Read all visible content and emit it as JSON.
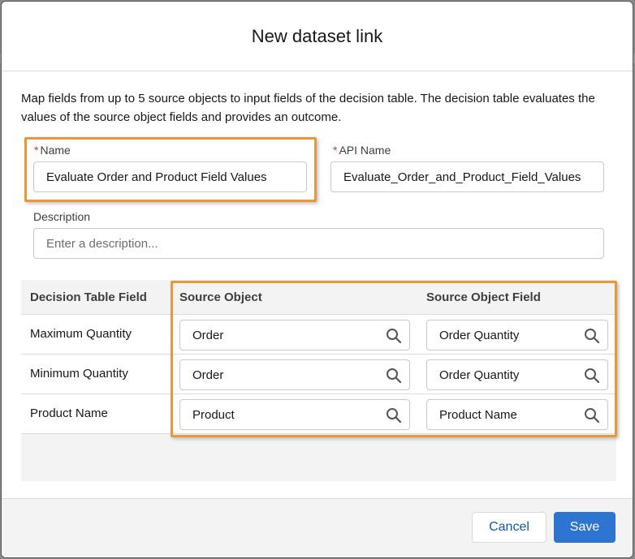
{
  "modal": {
    "title": "New dataset link",
    "intro": "Map fields from up to 5 source objects to input fields of the decision table. The decision table evaluates the values of the source object fields and provides an outcome."
  },
  "form": {
    "required_marker": "*",
    "name_label": "Name",
    "name_value": "Evaluate Order and Product Field Values",
    "api_name_label": "API Name",
    "api_name_value": "Evaluate_Order_and_Product_Field_Values",
    "description_label": "Description",
    "description_placeholder": "Enter a description..."
  },
  "table": {
    "headers": [
      "Decision Table Field",
      "Source Object",
      "Source Object Field"
    ],
    "rows": [
      {
        "field": "Maximum Quantity",
        "source_object": "Order",
        "source_object_field": "Order Quantity"
      },
      {
        "field": "Minimum Quantity",
        "source_object": "Order",
        "source_object_field": "Order Quantity"
      },
      {
        "field": "Product Name",
        "source_object": "Product",
        "source_object_field": "Product Name"
      }
    ]
  },
  "footer": {
    "cancel_label": "Cancel",
    "save_label": "Save"
  },
  "colors": {
    "highlight": "#e8973a",
    "brand_blue": "#2e74d1",
    "required": "#c23934"
  }
}
